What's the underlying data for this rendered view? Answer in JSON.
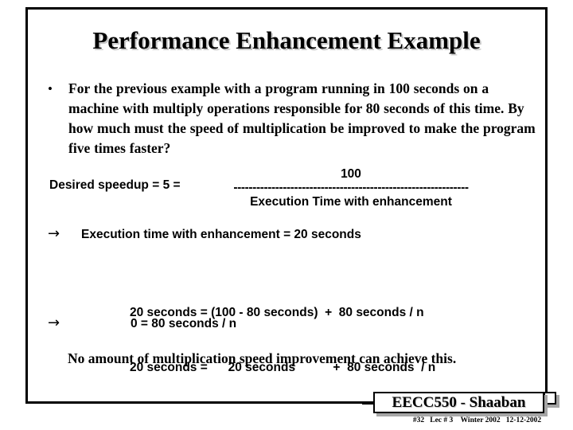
{
  "slide": {
    "title": "Performance Enhancement Example",
    "bullet": {
      "marker": "•",
      "text": "For the previous example with a program running in 100 seconds on a machine with multiply operations responsible for 80 seconds of this time.    By how much must the speed of multiplication be improved to make the program five times faster?"
    },
    "speedup": {
      "label": "Desired speedup =  5 =",
      "numerator": "100",
      "fraction_bar": "--------------------------------------------------------------",
      "denominator": "Execution Time with enhancement"
    },
    "arrow_glyph": "→",
    "conclusion_line_1": "Execution time with enhancement =  20 seconds",
    "equations": [
      "20 seconds = (100 - 80 seconds)  +  80 seconds / n",
      "20 seconds =      20 seconds           +  80 seconds  / n"
    ],
    "result_line": "0  =  80 seconds  / n",
    "conclusion": "No amount of multiplication speed improvement can achieve this."
  },
  "footer": {
    "course": "EECC550 - Shaaban",
    "meta": "#32   Lec # 3    Winter 2002   12-12-2002"
  },
  "colors": {
    "background": "#ffffff",
    "text": "#000000",
    "frame_border": "#000000",
    "shadow": "#a6a6a6",
    "title_shadow": "#c9c9c9"
  }
}
